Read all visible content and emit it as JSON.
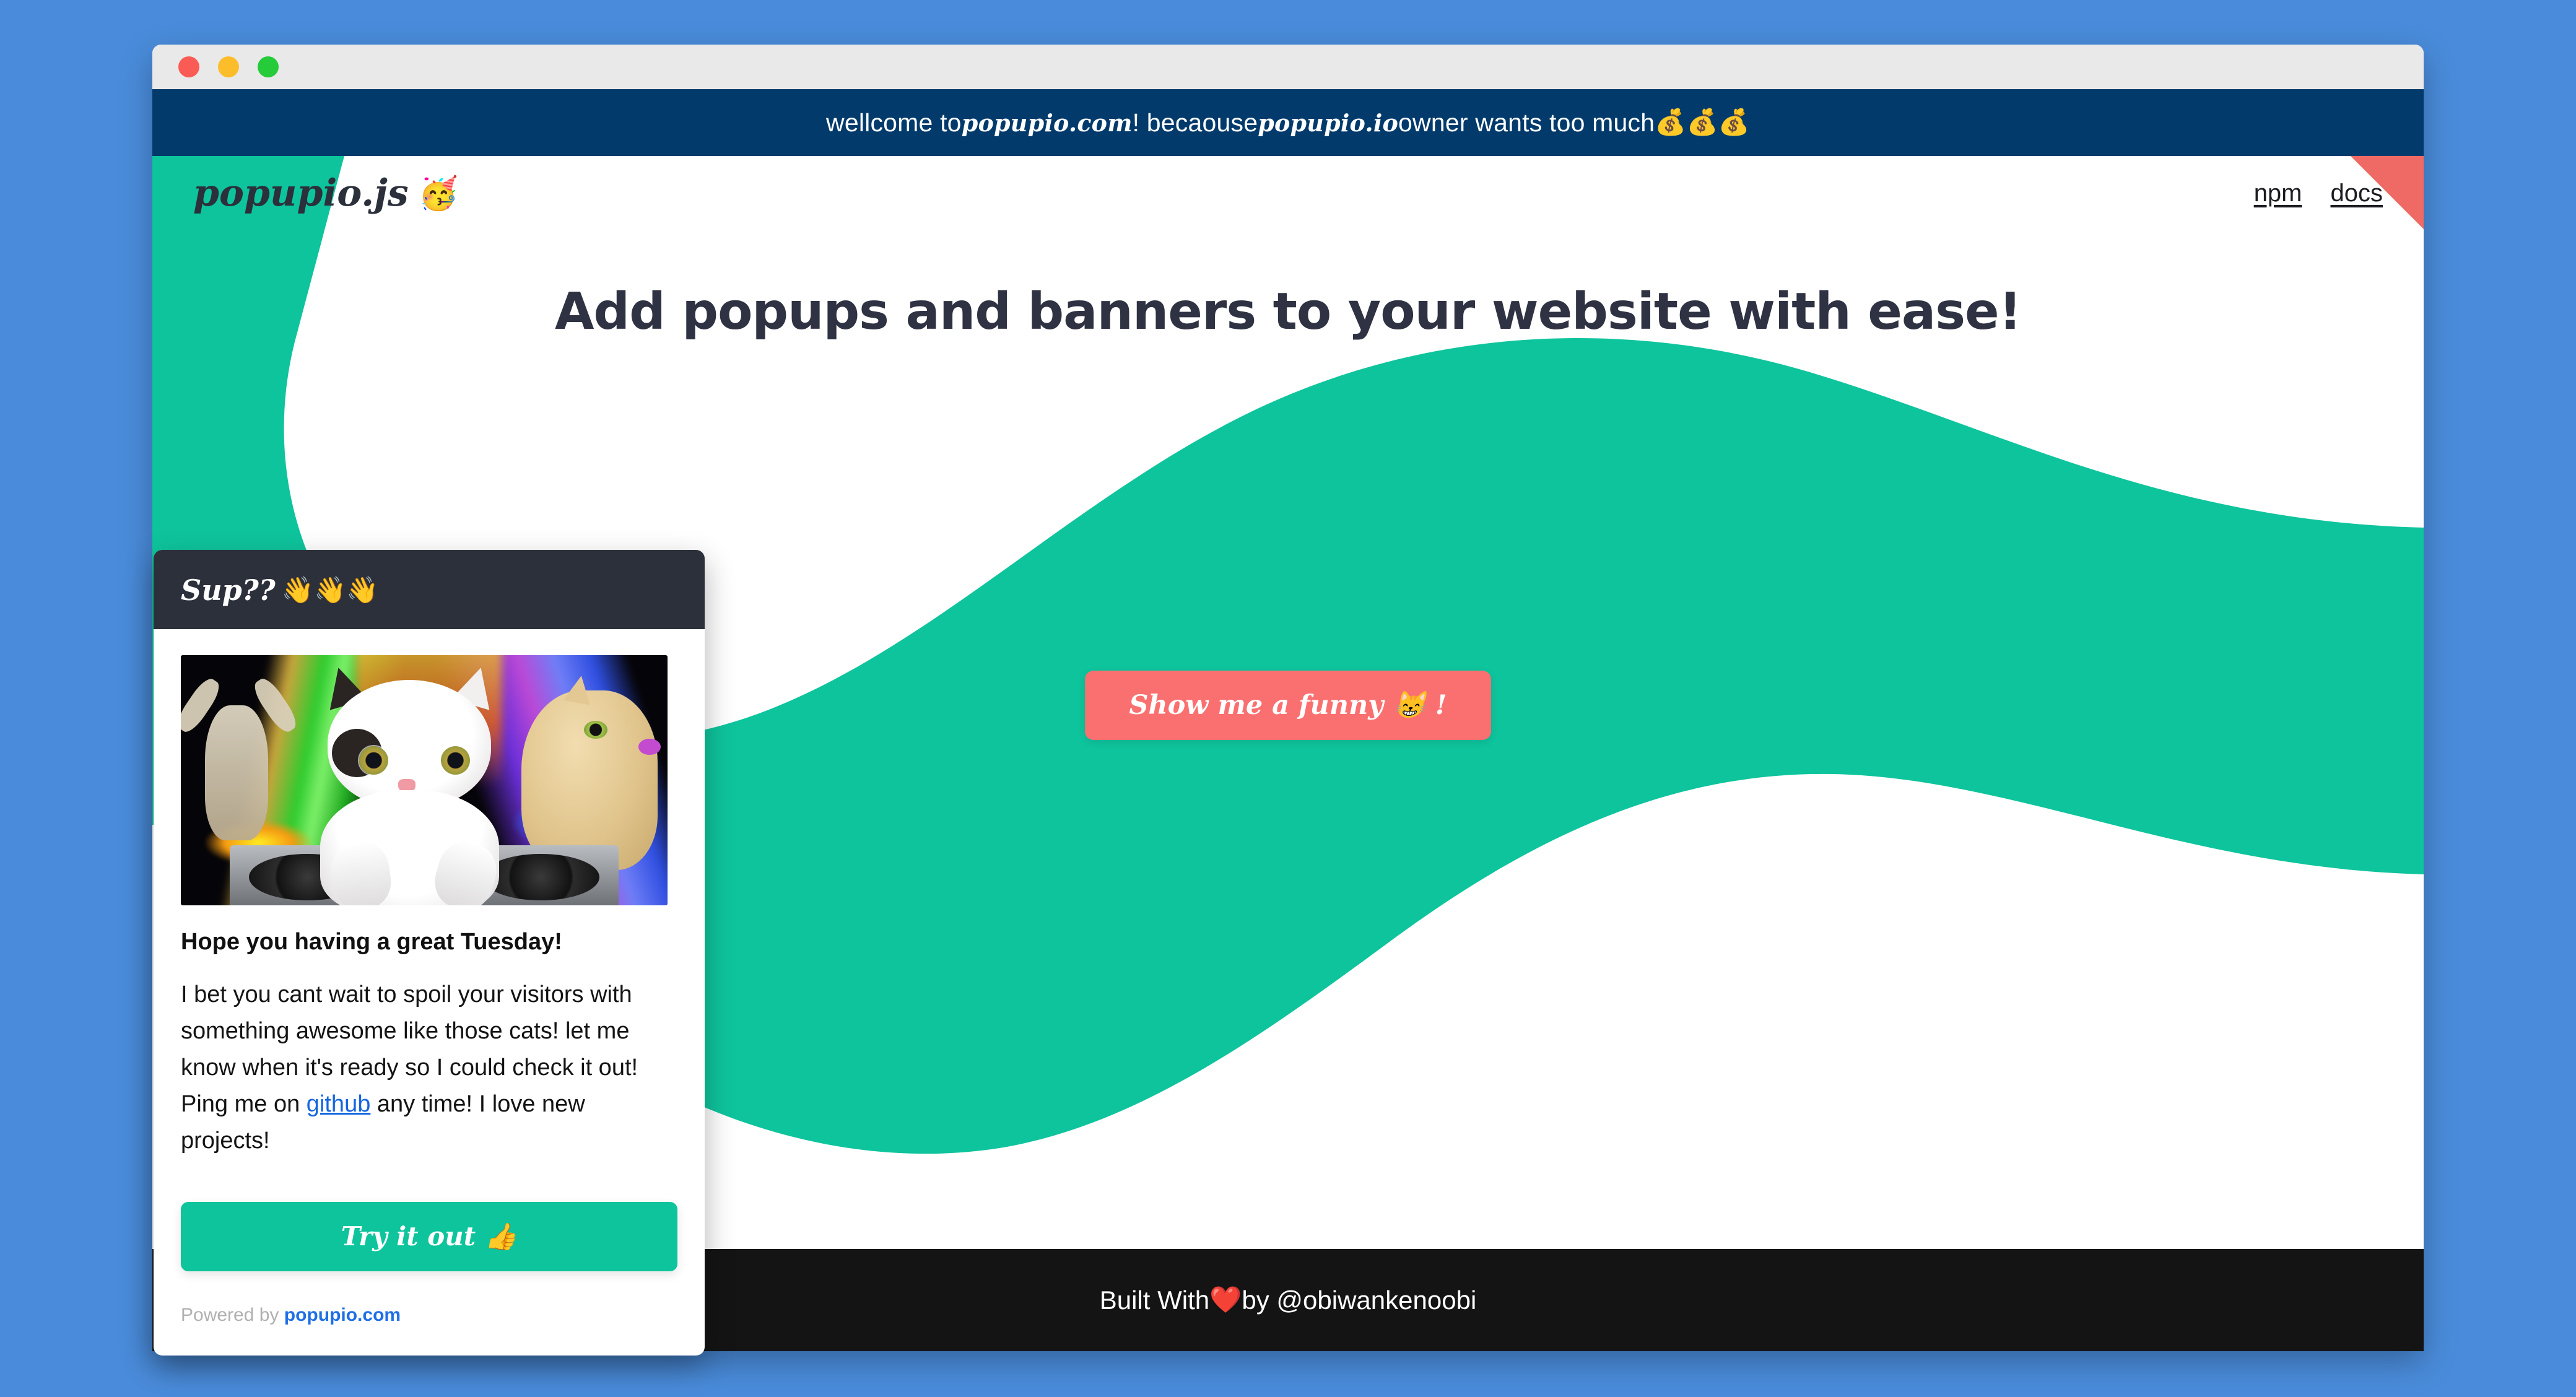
{
  "window": {
    "dots": [
      "close-dot",
      "minimize-dot",
      "maximize-dot"
    ]
  },
  "promo_banner": {
    "text_before": "wellcome to ",
    "brand_1": "popupio.com",
    "text_middle": "! becaouse ",
    "brand_2": "popupio.io",
    "text_after": " owner wants too much ",
    "emoji": "💰💰💰",
    "background_color": "#013a6b"
  },
  "header": {
    "logo_text": "popupio.js",
    "logo_emoji": "🥳",
    "nav": [
      {
        "label": "npm",
        "name": "nav-link-npm"
      },
      {
        "label": "docs",
        "name": "nav-link-docs"
      }
    ],
    "corner_accent_color": "#ef6a64"
  },
  "hero": {
    "title": "Add popups and banners to your website with ease!",
    "cta_label": "Show me a funny 😸 !",
    "cta_color": "#fa7070",
    "wave_color": "#0ec49c",
    "title_color": "#2e3243"
  },
  "footer": {
    "text_before": "Built With ",
    "emoji": "❤️",
    "text_after": " by @obiwankenoobi",
    "background_color": "#141414"
  },
  "popup": {
    "title": "Sup??",
    "title_emoji": "👋👋👋",
    "header_color": "#2b303b",
    "image_alt": "dj-cat-meme",
    "heading": "Hope you having a great Tuesday!",
    "paragraph_part_1": "I bet you cant wait to spoil your visitors with something awesome like those cats! let me know when it's ready so I could check it out! Ping me on ",
    "link_label": "github",
    "paragraph_part_2": " any time! I love new projects!",
    "action_label": "Try it out 👍",
    "action_color": "#0ec49c",
    "footer_prefix": "Powered by ",
    "footer_brand": "popupio.com"
  }
}
